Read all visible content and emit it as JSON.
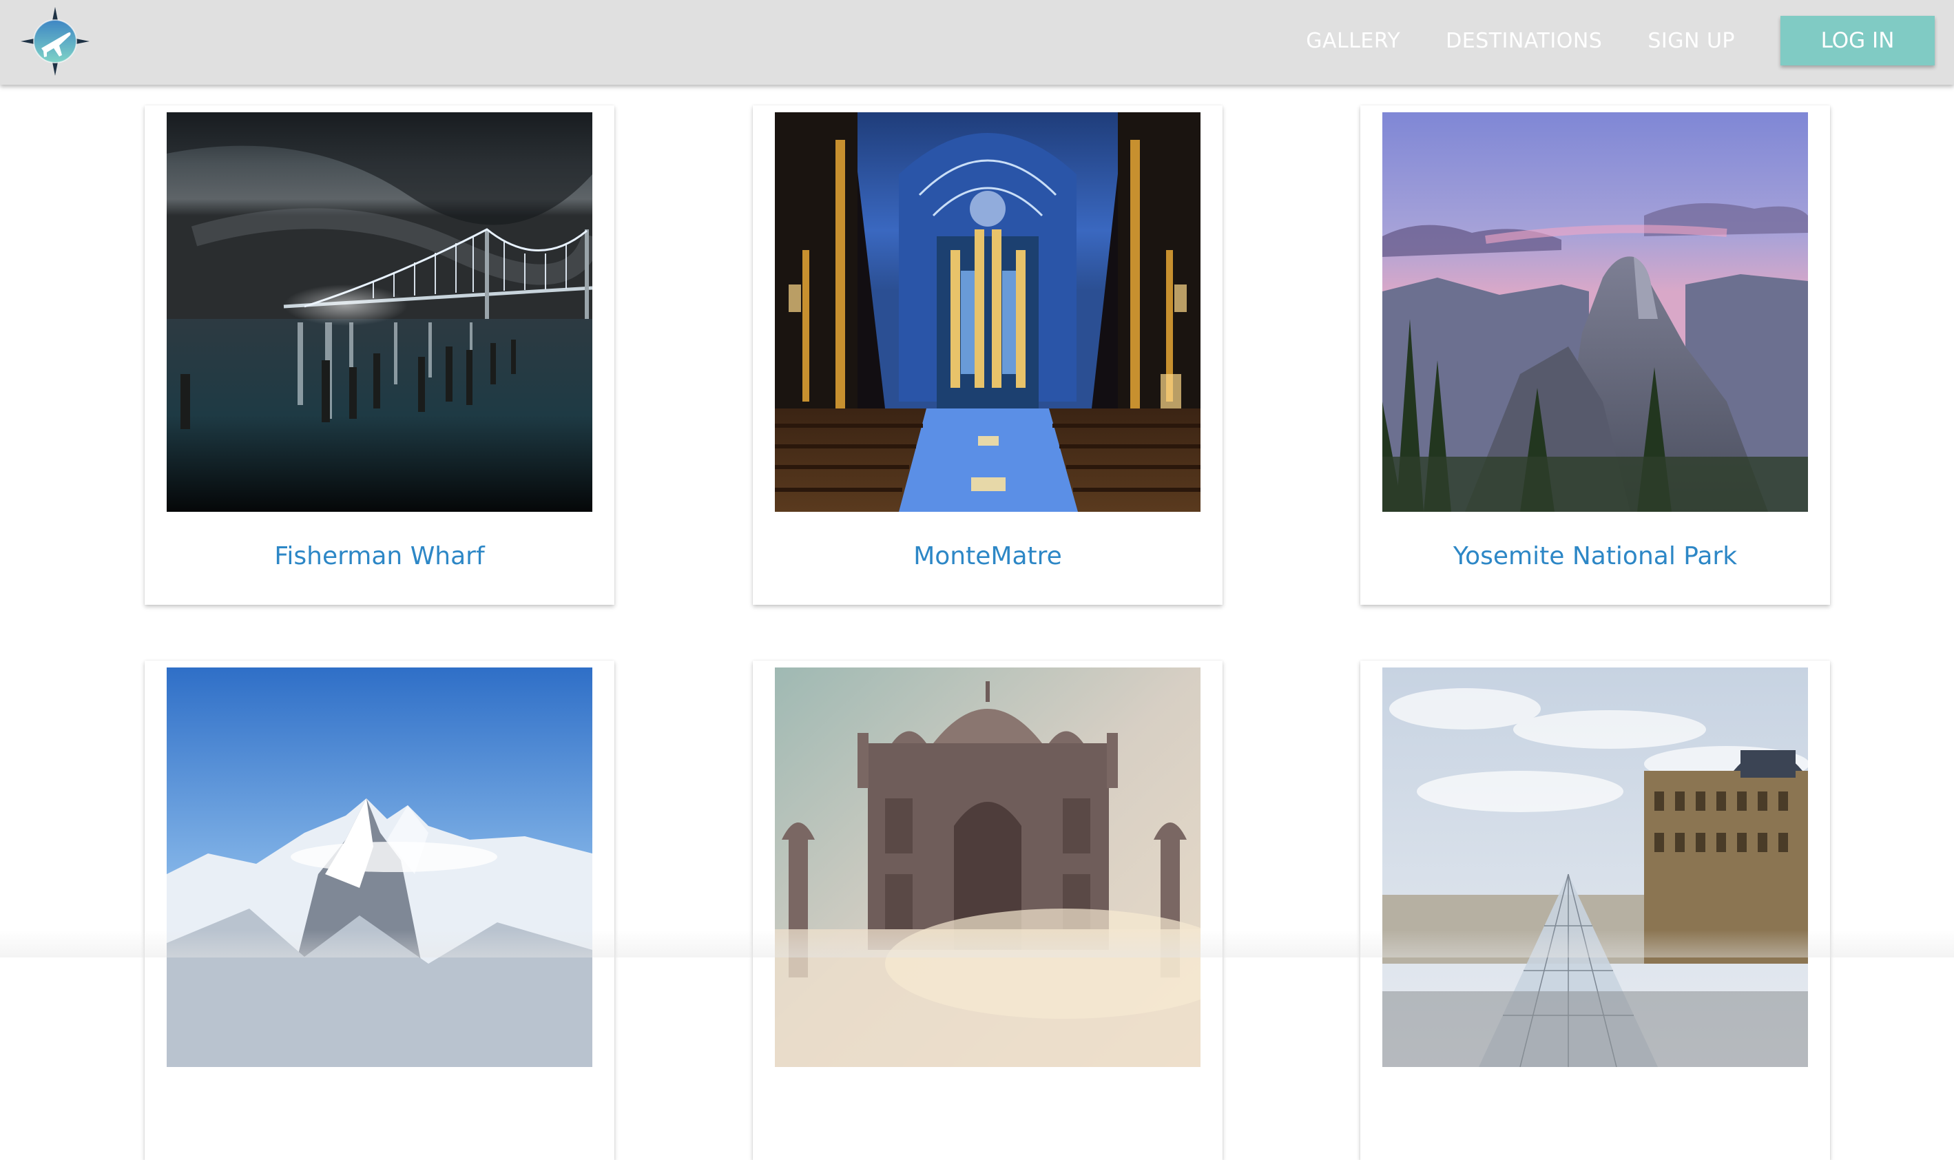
{
  "navbar": {
    "logo_icon": "compass-plane-logo-icon",
    "links": [
      {
        "label": "GALLERY"
      },
      {
        "label": "DESTINATIONS"
      },
      {
        "label": "SIGN UP"
      }
    ],
    "login_label": "LOG IN",
    "colors": {
      "bar": "#e0e0e0",
      "login_button": "#80cbc4",
      "link_text": "#ffffff"
    }
  },
  "gallery": {
    "caption_color": "#2d87c6",
    "cards": [
      {
        "title": "Fisherman Wharf",
        "image": "bay-bridge-at-night-photo"
      },
      {
        "title": "MonteMatre",
        "image": "cathedral-interior-photo"
      },
      {
        "title": "Yosemite National Park",
        "image": "half-dome-photo"
      },
      {
        "title": "",
        "image": "snowy-mountains-photo"
      },
      {
        "title": "",
        "image": "taj-mahal-in-mist-photo"
      },
      {
        "title": "",
        "image": "louvre-pyramid-photo"
      }
    ]
  }
}
